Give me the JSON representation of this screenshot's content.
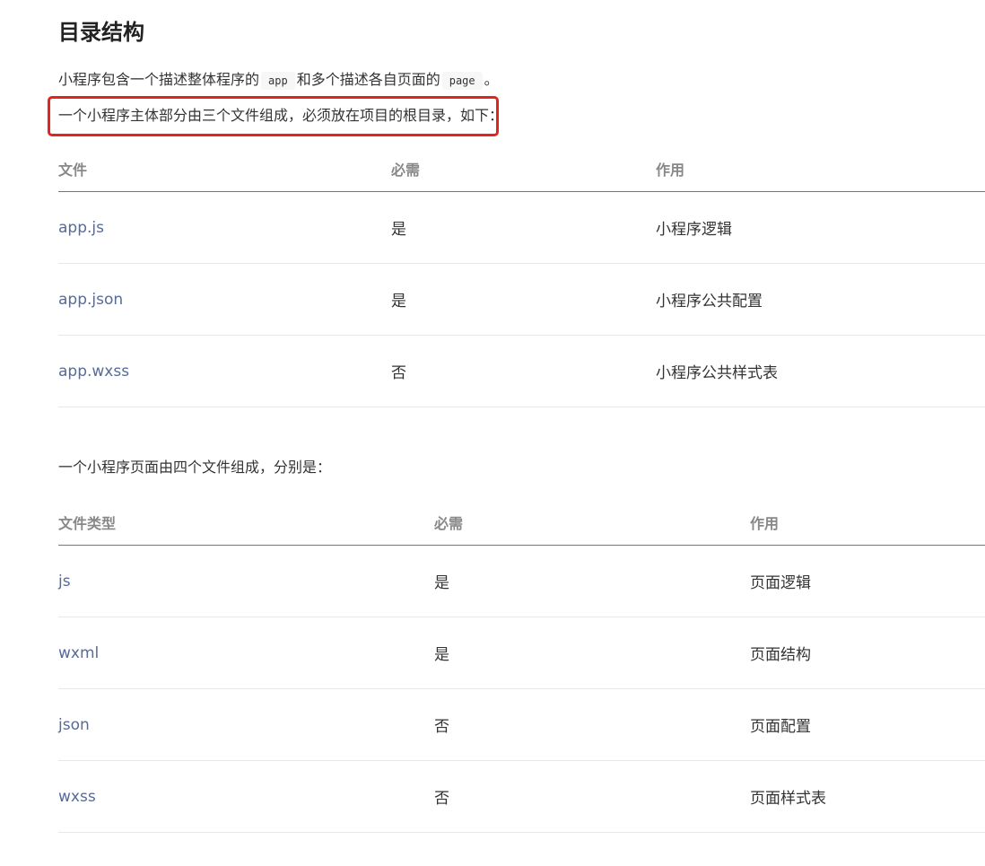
{
  "heading": "目录结构",
  "intro": {
    "before": "小程序包含一个描述整体程序的",
    "code1": "app",
    "middle": "和多个描述各自页面的",
    "code2": "page",
    "after": "。"
  },
  "main_intro": {
    "highlighted": "一个小程序主体部分由三个文件组成，必须放在项目的根目录，",
    "rest": "如下："
  },
  "table1": {
    "headers": [
      "文件",
      "必需",
      "作用"
    ],
    "rows": [
      [
        "app.js",
        "是",
        "小程序逻辑"
      ],
      [
        "app.json",
        "是",
        "小程序公共配置"
      ],
      [
        "app.wxss",
        "否",
        "小程序公共样式表"
      ]
    ]
  },
  "page_intro": "一个小程序页面由四个文件组成，分别是：",
  "table2": {
    "headers": [
      "文件类型",
      "必需",
      "作用"
    ],
    "rows": [
      [
        "js",
        "是",
        "页面逻辑"
      ],
      [
        "wxml",
        "是",
        "页面结构"
      ],
      [
        "json",
        "否",
        "页面配置"
      ],
      [
        "wxss",
        "否",
        "页面样式表"
      ]
    ]
  },
  "colors": {
    "highlight_border": "#e5221c",
    "file_link": "#576b95",
    "header_text": "#888888"
  }
}
